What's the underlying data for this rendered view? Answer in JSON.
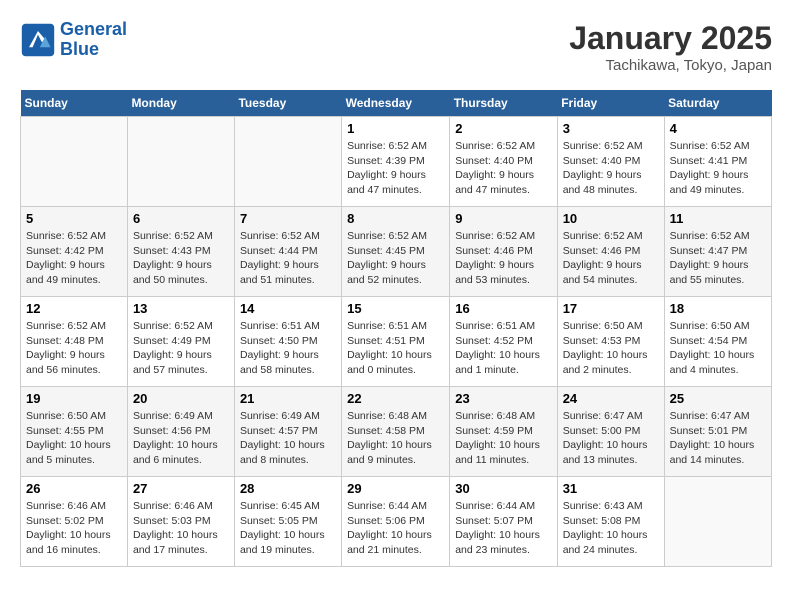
{
  "header": {
    "logo_line1": "General",
    "logo_line2": "Blue",
    "month_title": "January 2025",
    "location": "Tachikawa, Tokyo, Japan"
  },
  "weekdays": [
    "Sunday",
    "Monday",
    "Tuesday",
    "Wednesday",
    "Thursday",
    "Friday",
    "Saturday"
  ],
  "weeks": [
    [
      {
        "day": "",
        "sunrise": "",
        "sunset": "",
        "daylight": ""
      },
      {
        "day": "",
        "sunrise": "",
        "sunset": "",
        "daylight": ""
      },
      {
        "day": "",
        "sunrise": "",
        "sunset": "",
        "daylight": ""
      },
      {
        "day": "1",
        "sunrise": "Sunrise: 6:52 AM",
        "sunset": "Sunset: 4:39 PM",
        "daylight": "Daylight: 9 hours and 47 minutes."
      },
      {
        "day": "2",
        "sunrise": "Sunrise: 6:52 AM",
        "sunset": "Sunset: 4:40 PM",
        "daylight": "Daylight: 9 hours and 47 minutes."
      },
      {
        "day": "3",
        "sunrise": "Sunrise: 6:52 AM",
        "sunset": "Sunset: 4:40 PM",
        "daylight": "Daylight: 9 hours and 48 minutes."
      },
      {
        "day": "4",
        "sunrise": "Sunrise: 6:52 AM",
        "sunset": "Sunset: 4:41 PM",
        "daylight": "Daylight: 9 hours and 49 minutes."
      }
    ],
    [
      {
        "day": "5",
        "sunrise": "Sunrise: 6:52 AM",
        "sunset": "Sunset: 4:42 PM",
        "daylight": "Daylight: 9 hours and 49 minutes."
      },
      {
        "day": "6",
        "sunrise": "Sunrise: 6:52 AM",
        "sunset": "Sunset: 4:43 PM",
        "daylight": "Daylight: 9 hours and 50 minutes."
      },
      {
        "day": "7",
        "sunrise": "Sunrise: 6:52 AM",
        "sunset": "Sunset: 4:44 PM",
        "daylight": "Daylight: 9 hours and 51 minutes."
      },
      {
        "day": "8",
        "sunrise": "Sunrise: 6:52 AM",
        "sunset": "Sunset: 4:45 PM",
        "daylight": "Daylight: 9 hours and 52 minutes."
      },
      {
        "day": "9",
        "sunrise": "Sunrise: 6:52 AM",
        "sunset": "Sunset: 4:46 PM",
        "daylight": "Daylight: 9 hours and 53 minutes."
      },
      {
        "day": "10",
        "sunrise": "Sunrise: 6:52 AM",
        "sunset": "Sunset: 4:46 PM",
        "daylight": "Daylight: 9 hours and 54 minutes."
      },
      {
        "day": "11",
        "sunrise": "Sunrise: 6:52 AM",
        "sunset": "Sunset: 4:47 PM",
        "daylight": "Daylight: 9 hours and 55 minutes."
      }
    ],
    [
      {
        "day": "12",
        "sunrise": "Sunrise: 6:52 AM",
        "sunset": "Sunset: 4:48 PM",
        "daylight": "Daylight: 9 hours and 56 minutes."
      },
      {
        "day": "13",
        "sunrise": "Sunrise: 6:52 AM",
        "sunset": "Sunset: 4:49 PM",
        "daylight": "Daylight: 9 hours and 57 minutes."
      },
      {
        "day": "14",
        "sunrise": "Sunrise: 6:51 AM",
        "sunset": "Sunset: 4:50 PM",
        "daylight": "Daylight: 9 hours and 58 minutes."
      },
      {
        "day": "15",
        "sunrise": "Sunrise: 6:51 AM",
        "sunset": "Sunset: 4:51 PM",
        "daylight": "Daylight: 10 hours and 0 minutes."
      },
      {
        "day": "16",
        "sunrise": "Sunrise: 6:51 AM",
        "sunset": "Sunset: 4:52 PM",
        "daylight": "Daylight: 10 hours and 1 minute."
      },
      {
        "day": "17",
        "sunrise": "Sunrise: 6:50 AM",
        "sunset": "Sunset: 4:53 PM",
        "daylight": "Daylight: 10 hours and 2 minutes."
      },
      {
        "day": "18",
        "sunrise": "Sunrise: 6:50 AM",
        "sunset": "Sunset: 4:54 PM",
        "daylight": "Daylight: 10 hours and 4 minutes."
      }
    ],
    [
      {
        "day": "19",
        "sunrise": "Sunrise: 6:50 AM",
        "sunset": "Sunset: 4:55 PM",
        "daylight": "Daylight: 10 hours and 5 minutes."
      },
      {
        "day": "20",
        "sunrise": "Sunrise: 6:49 AM",
        "sunset": "Sunset: 4:56 PM",
        "daylight": "Daylight: 10 hours and 6 minutes."
      },
      {
        "day": "21",
        "sunrise": "Sunrise: 6:49 AM",
        "sunset": "Sunset: 4:57 PM",
        "daylight": "Daylight: 10 hours and 8 minutes."
      },
      {
        "day": "22",
        "sunrise": "Sunrise: 6:48 AM",
        "sunset": "Sunset: 4:58 PM",
        "daylight": "Daylight: 10 hours and 9 minutes."
      },
      {
        "day": "23",
        "sunrise": "Sunrise: 6:48 AM",
        "sunset": "Sunset: 4:59 PM",
        "daylight": "Daylight: 10 hours and 11 minutes."
      },
      {
        "day": "24",
        "sunrise": "Sunrise: 6:47 AM",
        "sunset": "Sunset: 5:00 PM",
        "daylight": "Daylight: 10 hours and 13 minutes."
      },
      {
        "day": "25",
        "sunrise": "Sunrise: 6:47 AM",
        "sunset": "Sunset: 5:01 PM",
        "daylight": "Daylight: 10 hours and 14 minutes."
      }
    ],
    [
      {
        "day": "26",
        "sunrise": "Sunrise: 6:46 AM",
        "sunset": "Sunset: 5:02 PM",
        "daylight": "Daylight: 10 hours and 16 minutes."
      },
      {
        "day": "27",
        "sunrise": "Sunrise: 6:46 AM",
        "sunset": "Sunset: 5:03 PM",
        "daylight": "Daylight: 10 hours and 17 minutes."
      },
      {
        "day": "28",
        "sunrise": "Sunrise: 6:45 AM",
        "sunset": "Sunset: 5:05 PM",
        "daylight": "Daylight: 10 hours and 19 minutes."
      },
      {
        "day": "29",
        "sunrise": "Sunrise: 6:44 AM",
        "sunset": "Sunset: 5:06 PM",
        "daylight": "Daylight: 10 hours and 21 minutes."
      },
      {
        "day": "30",
        "sunrise": "Sunrise: 6:44 AM",
        "sunset": "Sunset: 5:07 PM",
        "daylight": "Daylight: 10 hours and 23 minutes."
      },
      {
        "day": "31",
        "sunrise": "Sunrise: 6:43 AM",
        "sunset": "Sunset: 5:08 PM",
        "daylight": "Daylight: 10 hours and 24 minutes."
      },
      {
        "day": "",
        "sunrise": "",
        "sunset": "",
        "daylight": ""
      }
    ]
  ]
}
